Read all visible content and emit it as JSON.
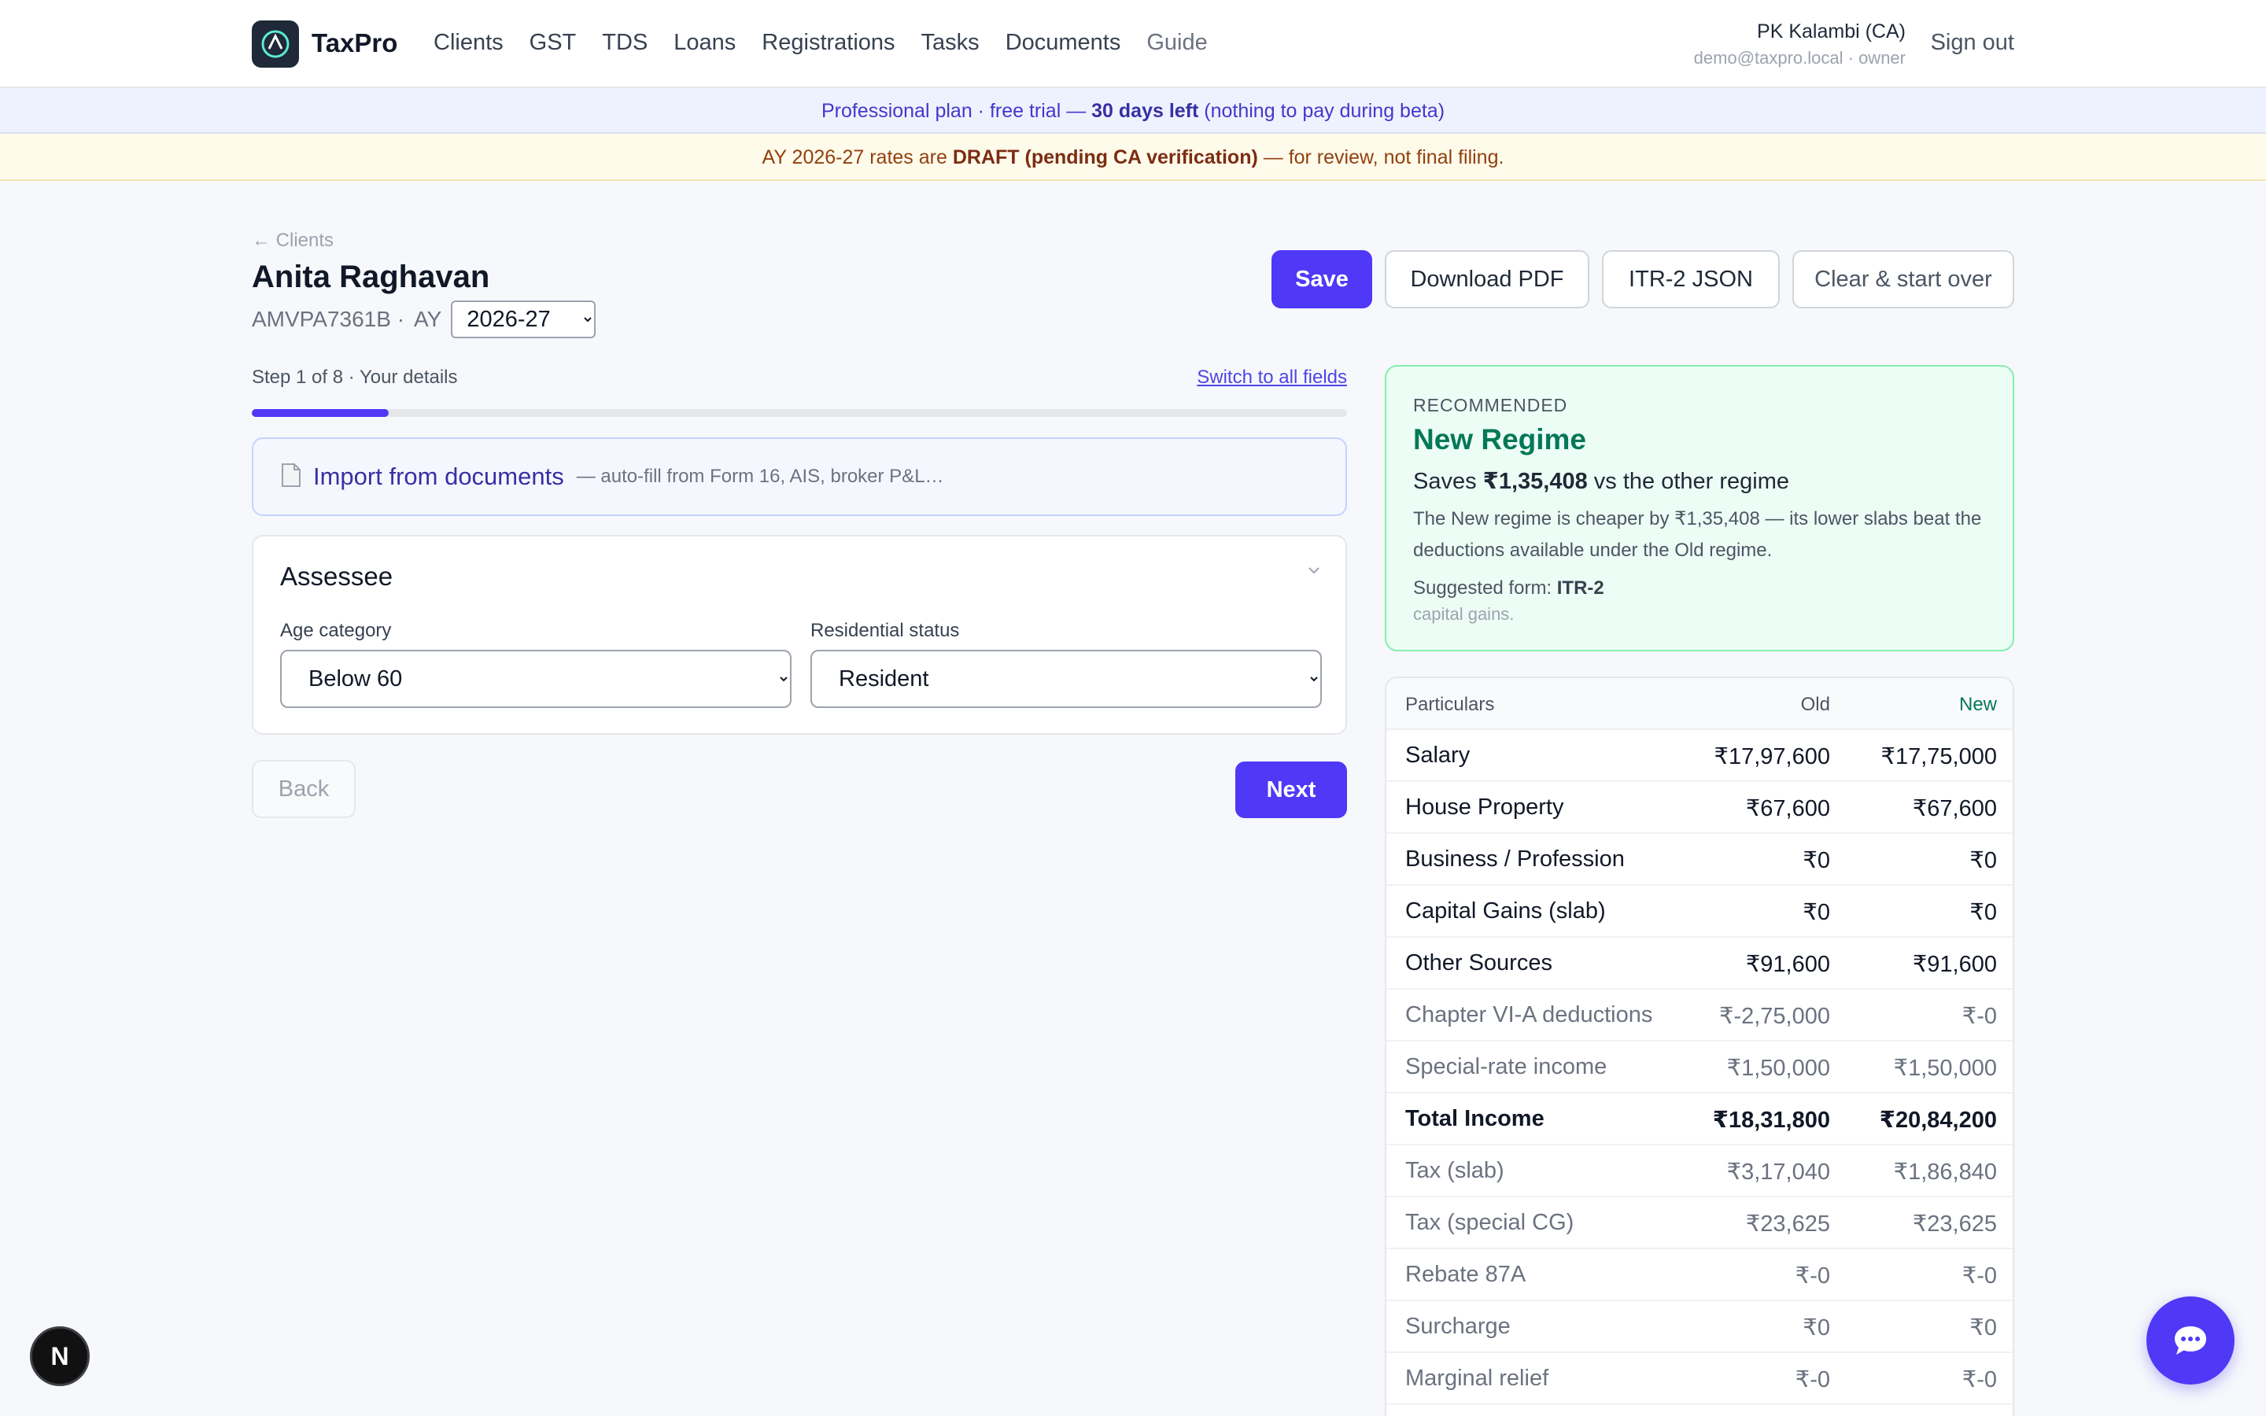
{
  "app": {
    "brand": "TaxPro",
    "nav": [
      "Clients",
      "GST",
      "TDS",
      "Loans",
      "Registrations",
      "Tasks",
      "Documents",
      "Guide"
    ],
    "user_name": "PK Kalambi (CA)",
    "user_email": "demo@taxpro.local · owner",
    "signout_label": "Sign out"
  },
  "banners": {
    "plan_prefix": "Professional plan · free trial — ",
    "plan_days": "30 days left",
    "plan_suffix": " (nothing to pay during beta)",
    "draft_prefix": "AY 2026-27 rates are ",
    "draft_bold": "DRAFT (pending CA verification)",
    "draft_suffix": " — for review, not final filing."
  },
  "client": {
    "back_label": "← Clients",
    "name": "Anita Raghavan",
    "pan": "AMVPA7361B ·",
    "ay_label": "AY",
    "ay_value": "2026-27"
  },
  "actions": {
    "save": "Save",
    "download_pdf": "Download PDF",
    "itr_json": "ITR-2 JSON",
    "clear": "Clear & start over"
  },
  "wizard": {
    "step_label": "Step 1 of 8 · Your details",
    "step_current": 1,
    "step_total": 8,
    "switch_label": "Switch to all fields",
    "import_title": "Import from documents",
    "import_sub": "— auto-fill from Form 16, AIS, broker P&L…",
    "section_title": "Assessee",
    "age_label": "Age category",
    "age_value": "Below 60",
    "residential_label": "Residential status",
    "residential_value": "Resident",
    "back_label": "Back",
    "next_label": "Next"
  },
  "recommendation": {
    "kicker": "RECOMMENDED",
    "title": "New Regime",
    "saves_prefix": "Saves ",
    "saves_amount": "₹1,35,408",
    "saves_suffix": " vs the other regime",
    "description": "The New regime is cheaper by ₹1,35,408 — its lower slabs beat the deductions available under the Old regime.",
    "form_label": "Suggested form: ",
    "form_value": "ITR-2",
    "note": "capital gains."
  },
  "comparison": {
    "headers": [
      "Particulars",
      "Old",
      "New"
    ],
    "rows": [
      {
        "label": "Salary",
        "old": "₹17,97,600",
        "new": "₹17,75,000",
        "style": "normal"
      },
      {
        "label": "House Property",
        "old": "₹67,600",
        "new": "₹67,600",
        "style": "normal"
      },
      {
        "label": "Business / Profession",
        "old": "₹0",
        "new": "₹0",
        "style": "normal"
      },
      {
        "label": "Capital Gains (slab)",
        "old": "₹0",
        "new": "₹0",
        "style": "normal"
      },
      {
        "label": "Other Sources",
        "old": "₹91,600",
        "new": "₹91,600",
        "style": "normal"
      },
      {
        "label": "Chapter VI-A deductions",
        "old": "₹-2,75,000",
        "new": "₹-0",
        "style": "muted"
      },
      {
        "label": "Special-rate income",
        "old": "₹1,50,000",
        "new": "₹1,50,000",
        "style": "muted"
      },
      {
        "label": "Total Income",
        "old": "₹18,31,800",
        "new": "₹20,84,200",
        "style": "bold"
      },
      {
        "label": "Tax (slab)",
        "old": "₹3,17,040",
        "new": "₹1,86,840",
        "style": "muted"
      },
      {
        "label": "Tax (special CG)",
        "old": "₹23,625",
        "new": "₹23,625",
        "style": "muted"
      },
      {
        "label": "Rebate 87A",
        "old": "₹-0",
        "new": "₹-0",
        "style": "muted"
      },
      {
        "label": "Surcharge",
        "old": "₹0",
        "new": "₹0",
        "style": "muted"
      },
      {
        "label": "Marginal relief",
        "old": "₹-0",
        "new": "₹-0",
        "style": "muted"
      }
    ]
  },
  "floating": {
    "dev_badge": "N"
  },
  "colors": {
    "accent": "#4f39f6",
    "recommend_green": "#047857",
    "draft_amber": "#92400e"
  },
  "icons": {
    "logo": "taxpro-logo-icon",
    "back": "arrow-left-icon",
    "import": "document-icon",
    "collapse": "chevron-down-icon",
    "chat": "chat-bubble-icon"
  }
}
